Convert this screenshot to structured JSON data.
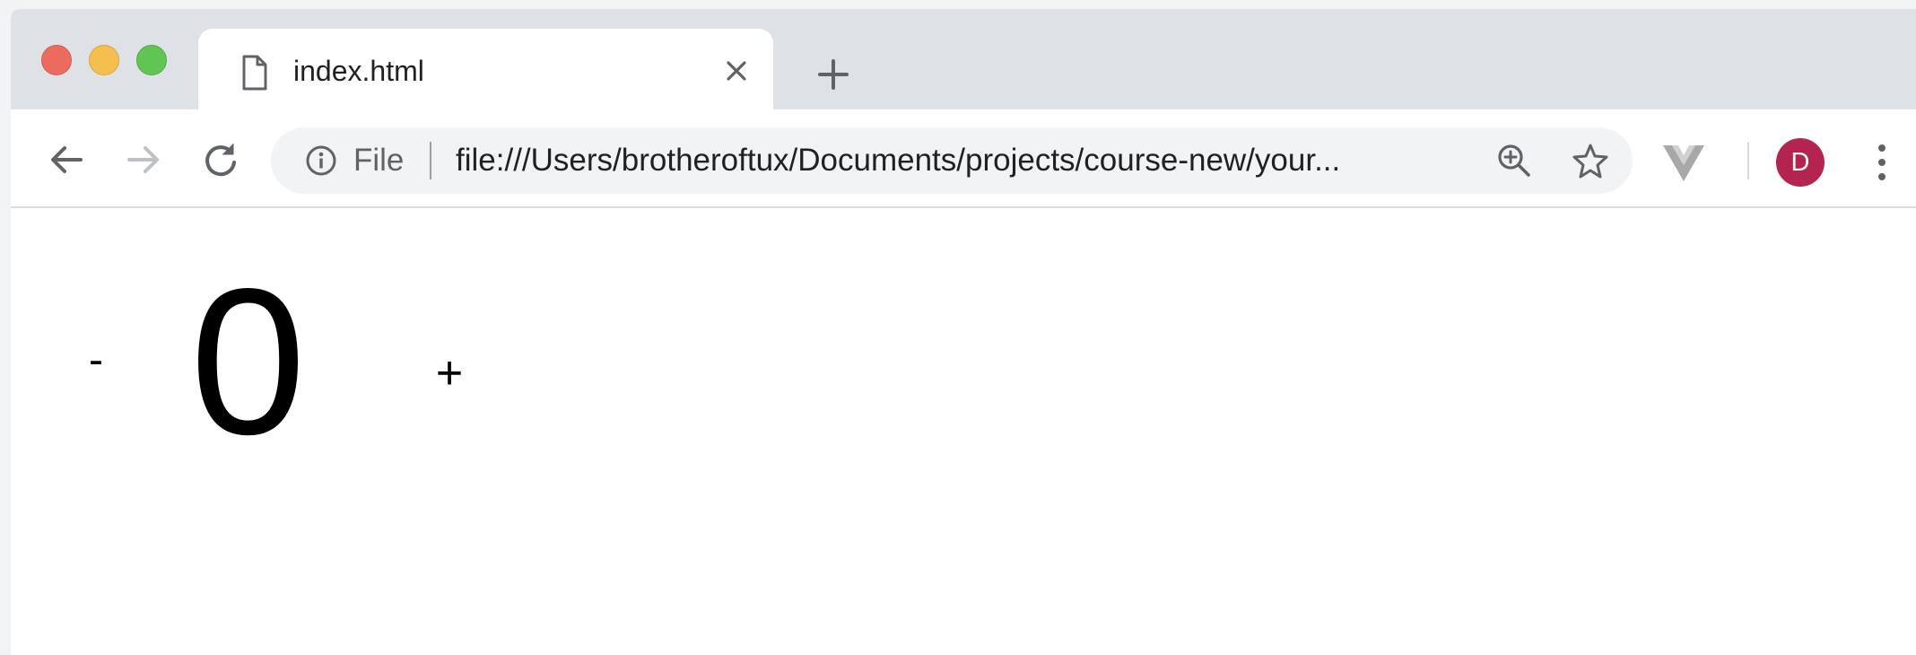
{
  "browser": {
    "tab": {
      "title": "index.html"
    },
    "address_bar": {
      "scheme_label": "File",
      "url": "file:///Users/brotheroftux/Documents/projects/course-new/your..."
    },
    "profile": {
      "initial": "D",
      "color": "#b3244f"
    },
    "icons": {
      "tab": "document-icon",
      "tab_close": "close-icon",
      "new_tab": "plus-icon",
      "back": "arrow-left-icon",
      "forward": "arrow-right-icon",
      "reload": "reload-icon",
      "site_info": "info-icon",
      "zoom": "zoom-in-icon",
      "bookmark": "star-icon",
      "extension": "vue-devtools-icon",
      "menu": "kebab-menu-icon"
    },
    "traffic_light_colors": [
      "#ed6a5e",
      "#f5bf4f",
      "#61c554"
    ]
  },
  "page": {
    "counter": {
      "decrement_label": "-",
      "value": "0",
      "increment_label": "+"
    }
  }
}
